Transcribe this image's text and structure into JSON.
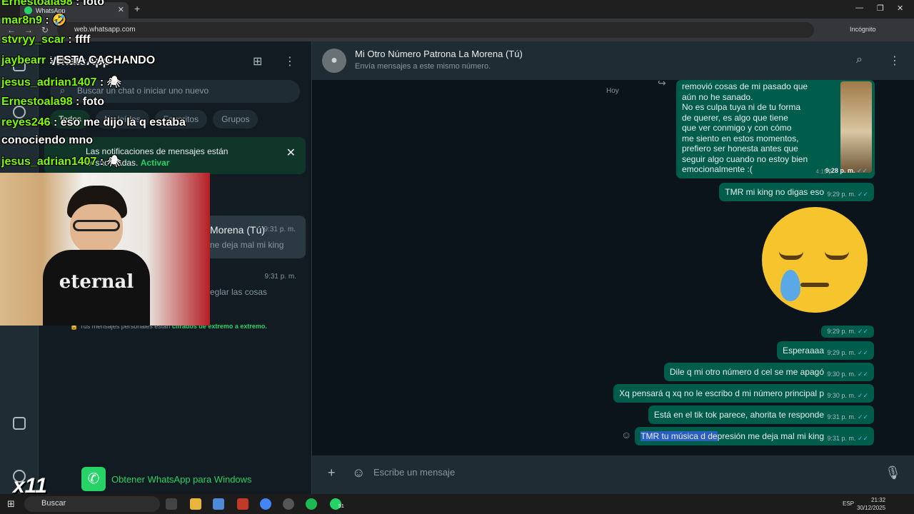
{
  "browser": {
    "tab_title": "WhatsApp",
    "url": "web.whatsapp.com",
    "incognito_label": "Incógnito"
  },
  "sidebar": {
    "title": "WhatsApp",
    "search_placeholder": "Buscar un chat o iniciar uno nuevo",
    "filters": [
      "Todos",
      "No leídos",
      "Favoritos",
      "Grupos"
    ],
    "notification": {
      "text": "Las notificaciones de mensajes están desactivadas.",
      "action": "Activar"
    },
    "chats": [
      {
        "name": "Morena (Tú)",
        "time": "9:31 p. m.",
        "preview": "ne deja mal mi king"
      },
      {
        "name": "",
        "time": "9:31 p. m.",
        "preview": "eglar las cosas"
      }
    ],
    "e2e_prefix": "Tus mensajes personales están",
    "e2e_link": "cifrados de extremo a extremo.",
    "get_app": "Obtener WhatsApp para Windows"
  },
  "chat": {
    "title": "Mi Otro Número Patrona La Morena (Tú)",
    "subtitle": "Envía mensajes a este mismo número.",
    "day_label": "Hoy",
    "quoted_message": {
      "lines": [
        "removió cosas de mi pasado que",
        "aún no he sanado.",
        "No es culpa tuya ni de tu forma",
        "de querer, es algo que tiene",
        "que ver conmigo y con cómo",
        "me siento en estos momentos,",
        "prefiero ser honesta antes que",
        "seguir algo cuando no estoy bien",
        "emocionalmente :("
      ],
      "old_time": "4:15 p.",
      "time": "9:28 p. m."
    },
    "messages": [
      {
        "text": "TMR mi king no digas eso",
        "time": "9:29 p. m."
      },
      {
        "text": "",
        "time": "9:29 p. m."
      },
      {
        "text": "Esperaaaa",
        "time": "9:29 p. m."
      },
      {
        "text": "Dile q mi otro número d cel se me apagó",
        "time": "9:30 p. m."
      },
      {
        "text": "Xq pensará q xq no le escribo d mi número principal p",
        "time": "9:30 p. m."
      },
      {
        "text": "Está en el tik tok parece, ahorita te responde",
        "time": "9:31 p. m."
      }
    ],
    "last_message": {
      "highlight": "TMR tu música d de",
      "rest": "presión me deja mal mi king",
      "time": "9:31 p. m."
    },
    "composer_placeholder": "Escribe un mensaje"
  },
  "overlay": {
    "chat": [
      {
        "user": "Ernestoala98",
        "msg": ": foto"
      },
      {
        "user": "mar8n9",
        "msg": ": 🤣"
      },
      {
        "user": "stvryy_scar",
        "msg": ": ffff"
      },
      {
        "user": "jaybearr",
        "msg": ": ESTA CACHANDO"
      },
      {
        "user": "jesus_adrian1407",
        "msg": ": 🕷"
      },
      {
        "user": "Ernestoala98",
        "msg": ": foto"
      },
      {
        "user": "reyes246",
        "msg": ": eso me dijo la q estaba"
      },
      {
        "user": "",
        "msg": "conociendo mno"
      },
      {
        "user": "jesus_adrian1407",
        "msg": ": 🕷"
      }
    ],
    "shirt_text": "eternal",
    "badge": "x11"
  },
  "taskbar": {
    "search": "Buscar",
    "lang": "ESP",
    "time": "21:32",
    "date": "30/12/2025",
    "badge": "51"
  },
  "colors": {
    "accent": "#25d366",
    "bubble": "#005c4b",
    "background": "#0b141a"
  }
}
